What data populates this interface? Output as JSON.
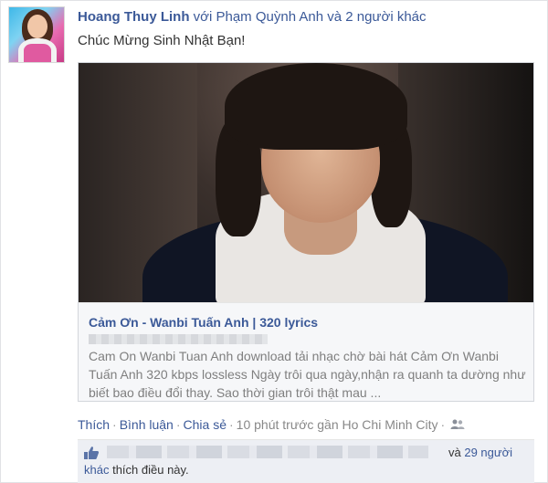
{
  "post": {
    "author": "Hoang Thuy Linh",
    "with_text": " với Phạm Quỳnh Anh và 2 người khác",
    "status": "Chúc Mừng Sinh Nhật Bạn!"
  },
  "attachment": {
    "title": "Cảm Ơn - Wanbi Tuấn Anh | 320 lyrics",
    "description": "Cam On Wanbi Tuan Anh download tải nhạc chờ bài hát Cảm Ơn Wanbi Tuấn Anh 320 kbps lossless Ngày trôi qua ngày,nhận ra quanh ta dường như biết bao điều đổi thay. Sao thời gian trôi thật mau ..."
  },
  "actions": {
    "like": "Thích",
    "comment": "Bình luận",
    "share": "Chia sẻ",
    "meta": "10 phút trước gần Ho Chi Minh City",
    "separator": "·",
    "privacy_icon": "people-icon"
  },
  "likes": {
    "and_text": "và ",
    "count_text": "29 người",
    "others_link": "khác",
    "suffix": " thích điều này.",
    "icon": "thumbs-up-icon"
  },
  "colors": {
    "link": "#3b5998",
    "likes_bg": "#edeff4",
    "muted": "#7f7f7f"
  }
}
